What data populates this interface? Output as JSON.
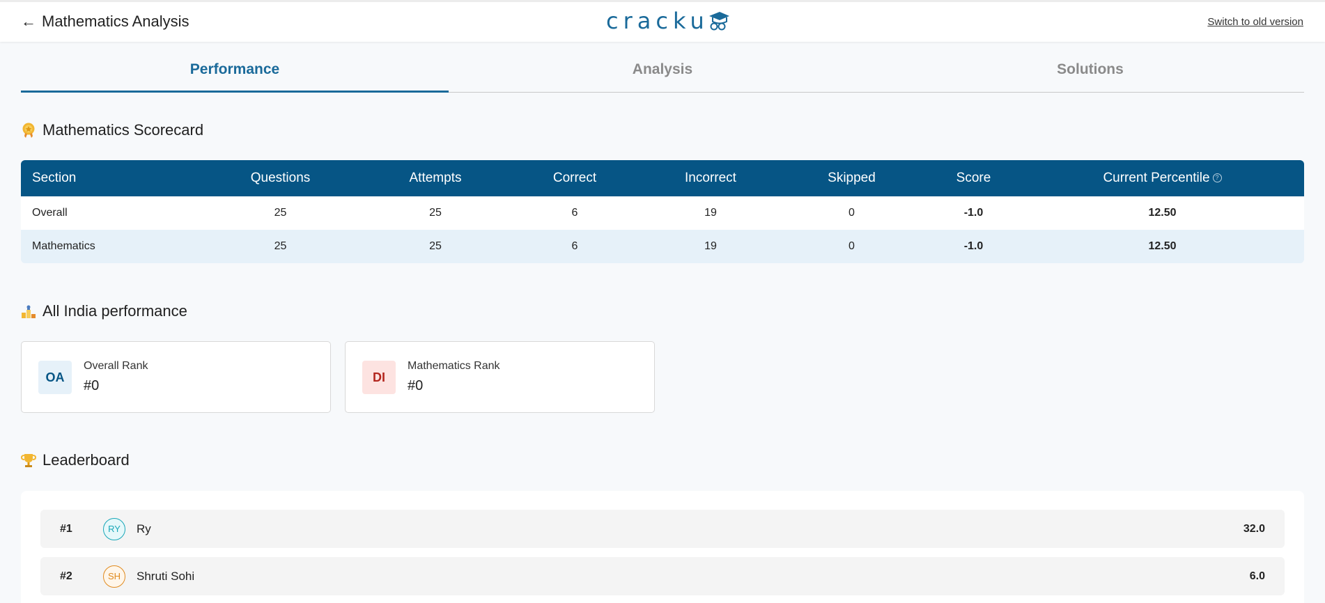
{
  "header": {
    "back_arrow": "←",
    "title": "Mathematics Analysis",
    "logo_text": "cracku",
    "switch_link": "Switch to old version"
  },
  "tabs": [
    {
      "label": "Performance",
      "active": true
    },
    {
      "label": "Analysis",
      "active": false
    },
    {
      "label": "Solutions",
      "active": false
    }
  ],
  "scorecard": {
    "title": "Mathematics Scorecard",
    "icon": "medal-icon",
    "columns": [
      "Section",
      "Questions",
      "Attempts",
      "Correct",
      "Incorrect",
      "Skipped",
      "Score",
      "Current Percentile"
    ],
    "rows": [
      [
        "Overall",
        "25",
        "25",
        "6",
        "19",
        "0",
        "-1.0",
        "12.50"
      ],
      [
        "Mathematics",
        "25",
        "25",
        "6",
        "19",
        "0",
        "-1.0",
        "12.50"
      ]
    ],
    "header_color": "#065585"
  },
  "india_performance": {
    "title": "All India performance",
    "icon": "podium-icon",
    "cards": [
      {
        "badge": "OA",
        "label": "Overall Rank",
        "value": "#0",
        "badge_bg": "#e6f1f9",
        "badge_color": "#065585"
      },
      {
        "badge": "DI",
        "label": "Mathematics Rank",
        "value": "#0",
        "badge_bg": "#fde3e1",
        "badge_color": "#b3261e"
      }
    ]
  },
  "leaderboard": {
    "title": "Leaderboard",
    "icon": "trophy-icon",
    "rows": [
      {
        "rank": "#1",
        "initials": "RY",
        "name": "Ry",
        "score": "32.0",
        "avatar_color": "#19a7b8",
        "avatar_bg": "#e6f8fa"
      },
      {
        "rank": "#2",
        "initials": "SH",
        "name": "Shruti Sohi",
        "score": "6.0",
        "avatar_color": "#e08a1e",
        "avatar_bg": "#fff6ea"
      }
    ]
  }
}
